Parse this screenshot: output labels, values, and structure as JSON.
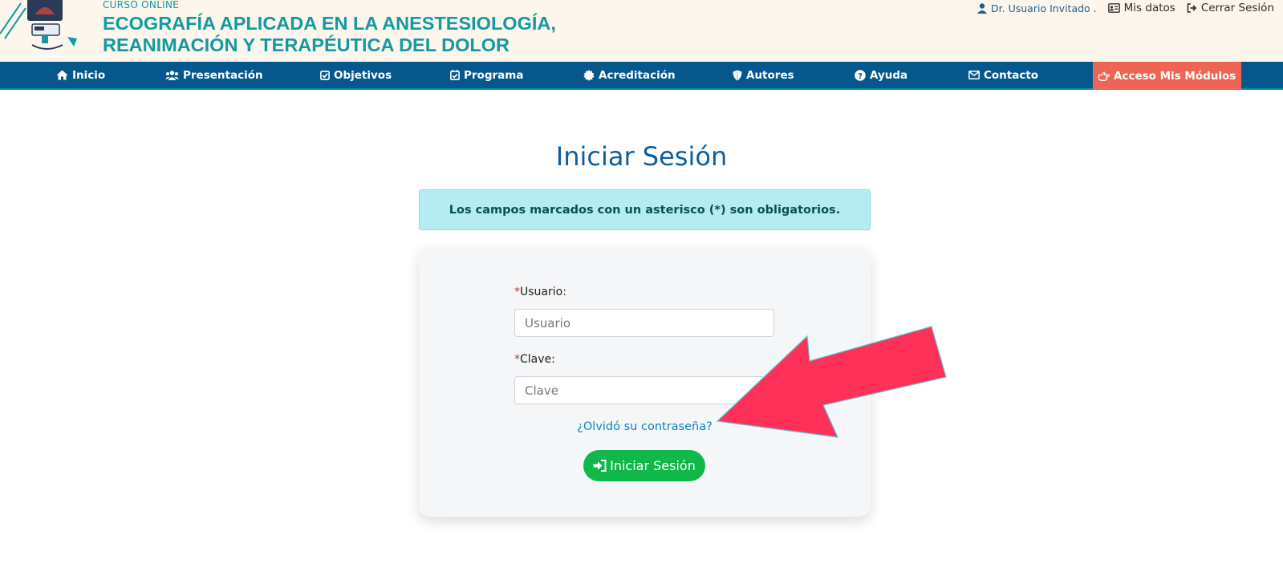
{
  "header": {
    "course_label": "CURSO  ONLINE",
    "title_line1": "ECOGRAFÍA APLICADA EN LA ANESTESIOLOGÍA,",
    "title_line2": "REANIMACIÓN Y TERAPÉUTICA DEL DOLOR",
    "user_name": "Dr. Usuario Invitado .",
    "my_data_label": "Mis datos",
    "logout_label": "Cerrar Sesión"
  },
  "nav": {
    "items": [
      {
        "label": "Inicio",
        "icon": "home-icon"
      },
      {
        "label": "Presentación",
        "icon": "users-icon"
      },
      {
        "label": "Objetivos",
        "icon": "check-square-icon"
      },
      {
        "label": "Programa",
        "icon": "calendar-check-icon"
      },
      {
        "label": "Acreditación",
        "icon": "certificate-icon"
      },
      {
        "label": "Autores",
        "icon": "shield-icon"
      },
      {
        "label": "Ayuda",
        "icon": "question-circle-icon"
      },
      {
        "label": "Contacto",
        "icon": "envelope-icon"
      },
      {
        "label": "Acceso Mis Módulos",
        "icon": "hand-pointing-icon"
      }
    ]
  },
  "login": {
    "title": "Iniciar Sesión",
    "notice": "Los campos marcados con un asterisco (*) son obligatorios.",
    "user_label": "Usuario:",
    "user_placeholder": "Usuario",
    "password_label": "Clave:",
    "password_placeholder": "Clave",
    "required_mark": "*",
    "forgot_link": "¿Olvidó su contraseña?",
    "submit_label": "Iniciar Sesión"
  },
  "colors": {
    "nav_bg": "#06588c",
    "title_teal": "#139aa2",
    "access_btn": "#ec6555",
    "submit_green": "#10b84a",
    "alert_bg": "#b4ecf2",
    "arrow": "#ff3159"
  }
}
